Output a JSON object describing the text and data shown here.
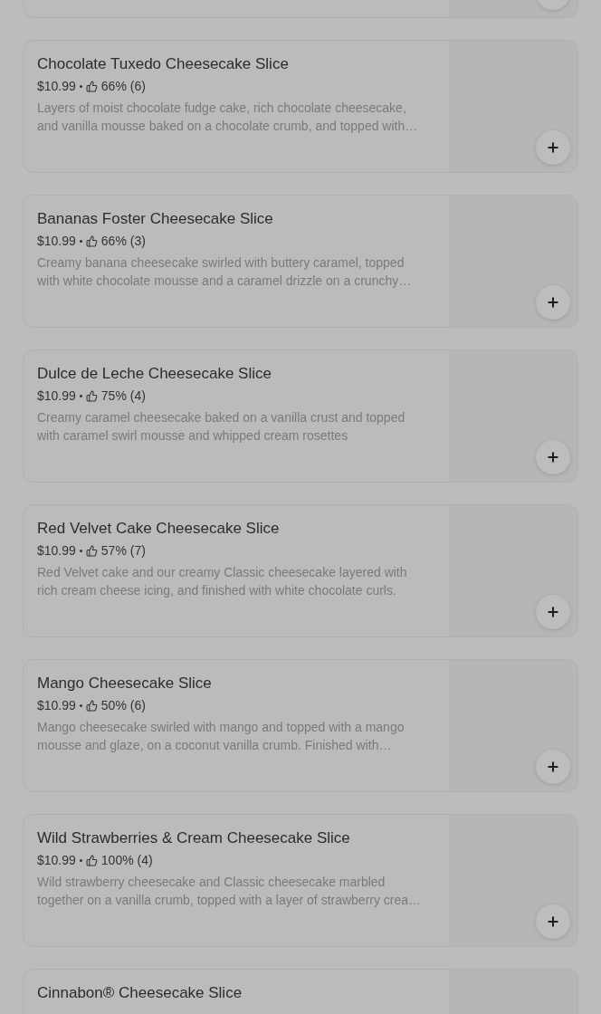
{
  "items": [
    {
      "title": "Chocolate Tuxedo Cheesecake Slice",
      "price": "$10.99",
      "rating": "66% (6)",
      "description": "Layers of moist chocolate fudge cake, rich chocolate cheesecake, and vanilla mousse baked on a chocolate crumb, and topped with…"
    },
    {
      "title": "Bananas Foster Cheesecake Slice",
      "price": "$10.99",
      "rating": "66% (3)",
      "description": "Creamy banana cheesecake swirled with buttery caramel, topped with white chocolate mousse and a caramel drizzle on a crunchy…"
    },
    {
      "title": "Dulce de Leche Cheesecake Slice",
      "price": "$10.99",
      "rating": "75% (4)",
      "description": "Creamy caramel cheesecake baked on a vanilla crust and topped with caramel swirl mousse and whipped cream rosettes"
    },
    {
      "title": "Red Velvet Cake Cheesecake Slice",
      "price": "$10.99",
      "rating": "57% (7)",
      "description": "Red Velvet cake and our creamy Classic cheesecake layered with rich cream cheese icing, and finished with white chocolate curls."
    },
    {
      "title": "Mango Cheesecake Slice",
      "price": "$10.99",
      "rating": "50% (6)",
      "description": "Mango cheesecake swirled with mango and topped with a mango mousse and glaze, on a coconut vanilla crumb. Finished with…"
    },
    {
      "title": "Wild Strawberries & Cream Cheesecake Slice",
      "price": "$10.99",
      "rating": "100% (4)",
      "description": "Wild strawberry cheesecake and Classic cheesecake marbled together on a vanilla crumb, topped with a layer of strawberry crea…"
    },
    {
      "title": "Cinnabon® Cheesecake Slice"
    }
  ]
}
